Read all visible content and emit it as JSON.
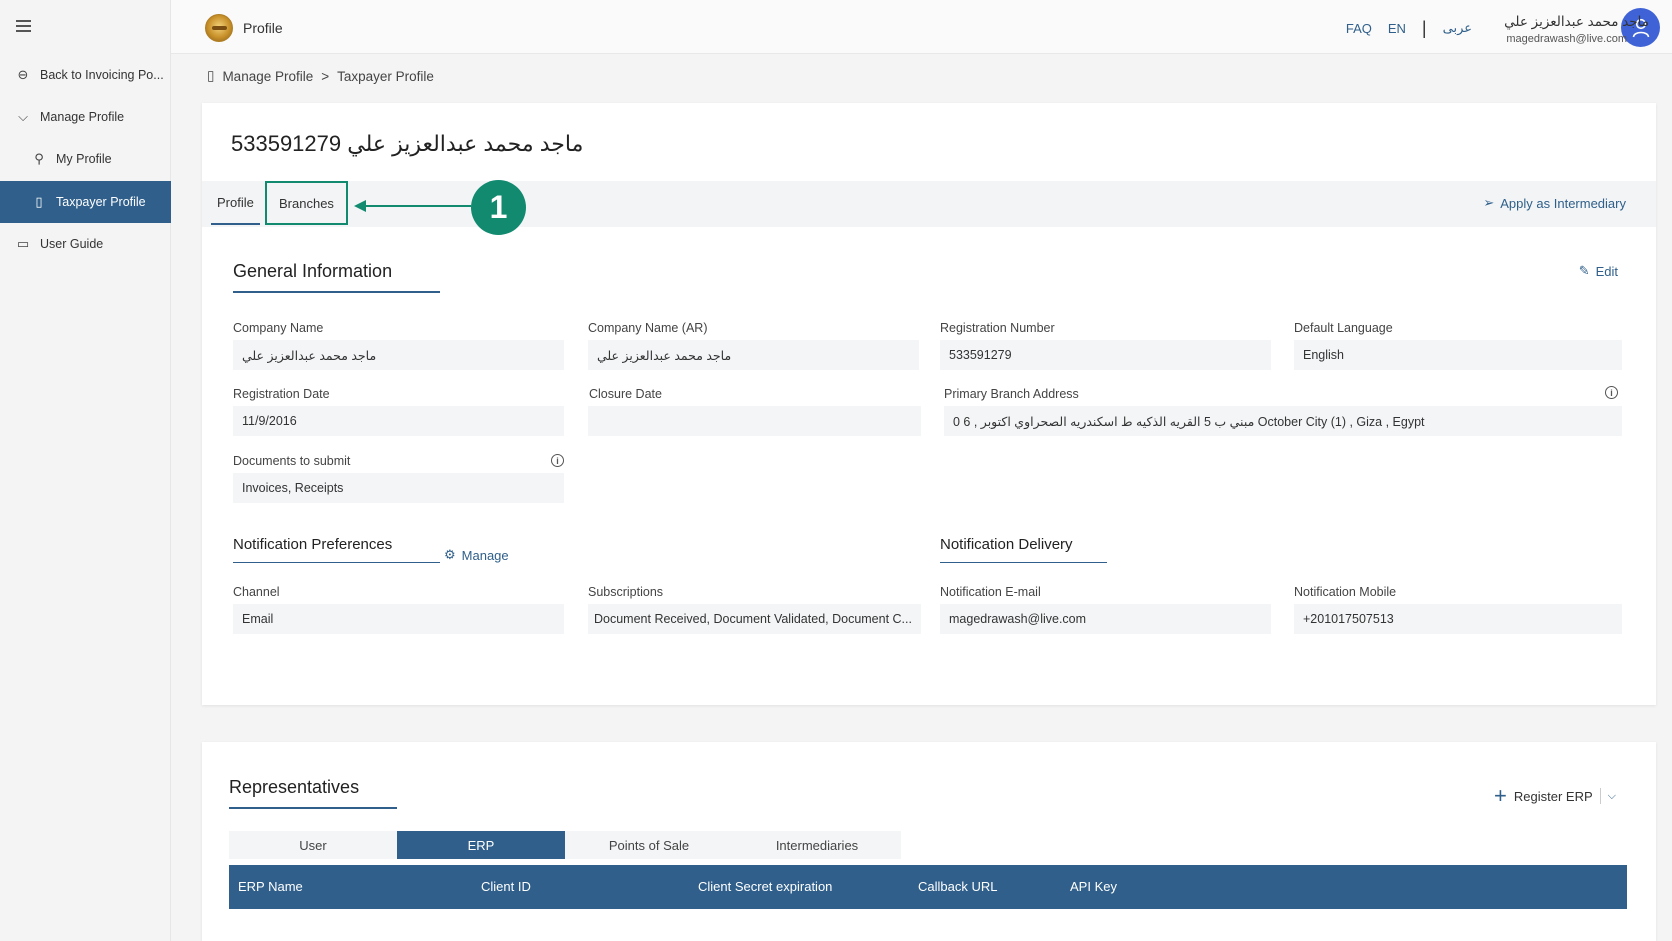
{
  "sidebar": {
    "items": [
      {
        "label": "Back to Invoicing Po...",
        "icon": "back-circle-icon"
      },
      {
        "label": "Manage Profile",
        "icon": "chevron-down-icon"
      },
      {
        "label": "My Profile",
        "icon": "person-icon"
      },
      {
        "label": "Taxpayer Profile",
        "icon": "document-icon"
      },
      {
        "label": "User Guide",
        "icon": "book-icon"
      }
    ]
  },
  "header": {
    "app_title": "Profile",
    "faq": "FAQ",
    "lang_en": "EN",
    "separator": "|",
    "lang_ar": "عربى",
    "user_name": "ماجد محمد عبدالعزيز علي",
    "user_email": "magedrawash@live.com"
  },
  "breadcrumb": {
    "items": [
      "Manage Profile",
      "Taxpayer Profile"
    ],
    "separator": ">"
  },
  "profile": {
    "title": "533591279  ماجد محمد عبدالعزيز علي",
    "tabs": [
      "Profile",
      "Branches"
    ],
    "callout_number": "1",
    "apply_label": "Apply as Intermediary",
    "general_title": "General Information",
    "edit_label": "Edit",
    "fields": {
      "company_name": {
        "label": "Company Name",
        "value": "ماجد محمد عبدالعزيز علي"
      },
      "company_name_ar": {
        "label": "Company Name (AR)",
        "value": "ماجد محمد عبدالعزيز علي"
      },
      "registration_number": {
        "label": "Registration Number",
        "value": "533591279"
      },
      "default_language": {
        "label": "Default Language",
        "value": "English"
      },
      "registration_date": {
        "label": "Registration Date",
        "value": "11/9/2016"
      },
      "closure_date": {
        "label": "Closure Date",
        "value": ""
      },
      "primary_branch_address": {
        "label": "Primary Branch Address",
        "value": "0  6  , مبني ب 5 القريه الذكيه ط اسكندريه الصحراوي اكتوبر October City (1) , Giza , Egypt"
      },
      "documents_to_submit": {
        "label": "Documents to submit",
        "value": "Invoices, Receipts"
      }
    },
    "notification_preferences_title": "Notification Preferences",
    "manage_label": "Manage",
    "notification_delivery_title": "Notification Delivery",
    "notification_fields": {
      "channel": {
        "label": "Channel",
        "value": "Email"
      },
      "subscriptions": {
        "label": "Subscriptions",
        "value": "Document Received, Document Validated, Document C..."
      },
      "email": {
        "label": "Notification E-mail",
        "value": "magedrawash@live.com"
      },
      "mobile": {
        "label": "Notification Mobile",
        "value": "+201017507513"
      }
    }
  },
  "representatives": {
    "title": "Representatives",
    "register_label": "Register ERP",
    "tabs": [
      "User",
      "ERP",
      "Points of Sale",
      "Intermediaries"
    ],
    "active_tab": "ERP",
    "columns": [
      "ERP Name",
      "Client ID",
      "Client Secret expiration",
      "Callback URL",
      "API Key"
    ]
  },
  "colors": {
    "accent": "#2f5f8a",
    "callout": "#128a70",
    "avatar": "#3f63d6"
  }
}
